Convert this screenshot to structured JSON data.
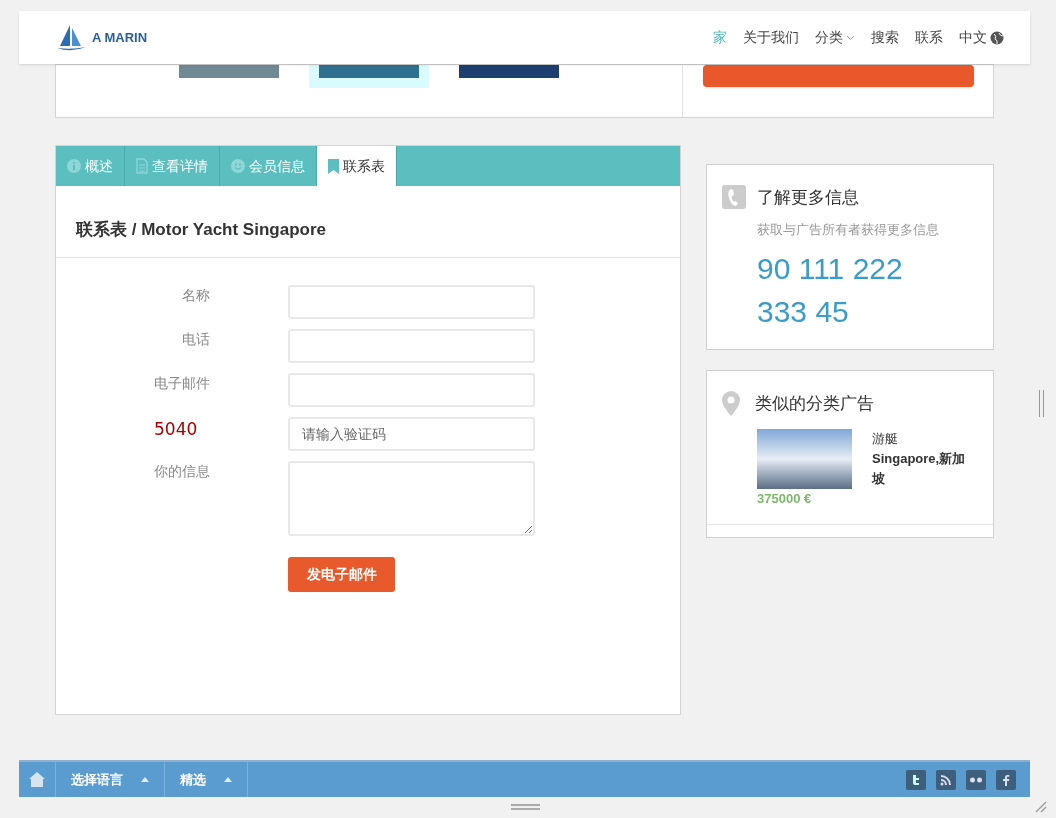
{
  "header": {
    "logo": "A MARIN",
    "nav": [
      {
        "label": "家",
        "selected": true,
        "kind": "link"
      },
      {
        "label": "关于我们",
        "selected": false,
        "kind": "link"
      },
      {
        "label": "分类",
        "selected": false,
        "kind": "dropdown"
      },
      {
        "label": "搜索",
        "selected": false,
        "kind": "link"
      },
      {
        "label": "联系",
        "selected": false,
        "kind": "link"
      },
      {
        "label": "中文",
        "selected": false,
        "kind": "language"
      }
    ]
  },
  "tabs": [
    {
      "label": "概述",
      "selected": false
    },
    {
      "label": "查看详情",
      "selected": false
    },
    {
      "label": "会员信息",
      "selected": false
    },
    {
      "label": "联系表",
      "selected": true
    }
  ],
  "form": {
    "title": "联系表 / Motor Yacht Singapore",
    "fields": [
      {
        "label": "名称",
        "kind": "input"
      },
      {
        "label": "电话",
        "kind": "input"
      },
      {
        "label": "电子邮件",
        "kind": "input"
      },
      {
        "label": "5040",
        "kind": "captcha",
        "placeholder": "请输入验证码"
      },
      {
        "label": "你的信息",
        "kind": "textarea"
      }
    ],
    "submit": "发电子邮件"
  },
  "info_card": {
    "title": "了解更多信息",
    "subtitle": "获取与广告所有者获得更多信息",
    "phone": "90 111 222 333 45"
  },
  "similar_card": {
    "title": "类似的分类广告",
    "items": [
      {
        "title": "游艇",
        "location": "Singapore,新加坡",
        "price": "375000 €"
      }
    ]
  },
  "bottom_bar": {
    "menus": [
      "选择语言",
      "精选"
    ]
  }
}
